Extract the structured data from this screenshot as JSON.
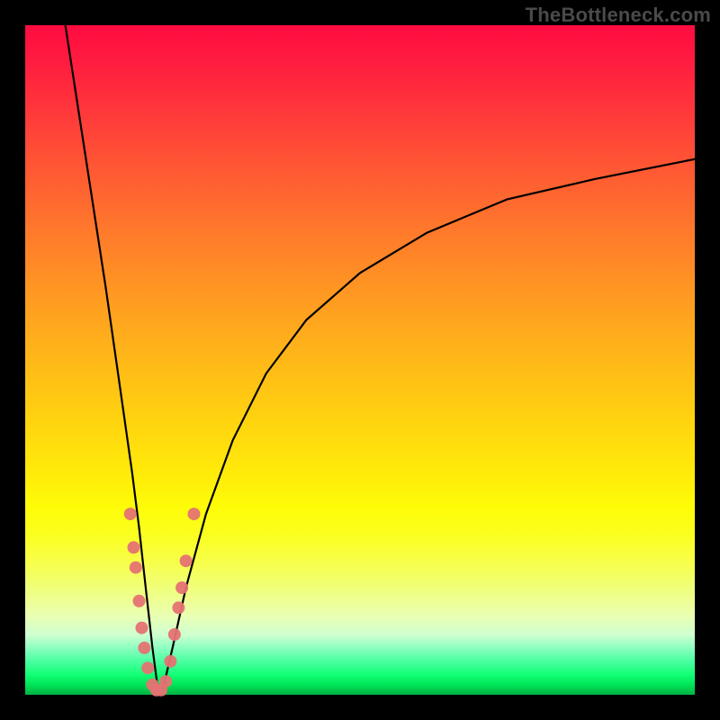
{
  "watermark": "TheBottleneck.com",
  "chart_data": {
    "type": "line",
    "title": "",
    "xlabel": "",
    "ylabel": "",
    "xlim": [
      0,
      100
    ],
    "ylim": [
      0,
      100
    ],
    "grid": false,
    "description": "Bottleneck percentage curve over normalized hardware axis. Descends from 100% at x≈6 to ~0% at the notch around x≈19–21, then asymptotically rises toward ~80% at x=100. Pink dot markers cluster along the curve around the notch between y≈0 and y≈27.",
    "series": [
      {
        "name": "bottleneck-curve",
        "x": [
          6,
          8,
          10,
          12,
          14,
          15,
          16,
          17,
          18,
          19,
          19.8,
          20.6,
          22,
          24,
          27,
          31,
          36,
          42,
          50,
          60,
          72,
          85,
          100
        ],
        "y": [
          100,
          87,
          74,
          61,
          47,
          40,
          33,
          25,
          16,
          7,
          1,
          1,
          7,
          16,
          27,
          38,
          48,
          56,
          63,
          69,
          74,
          77,
          80
        ]
      }
    ],
    "markers": [
      {
        "x": 15.7,
        "y": 27
      },
      {
        "x": 16.2,
        "y": 22
      },
      {
        "x": 16.5,
        "y": 19
      },
      {
        "x": 17.0,
        "y": 14
      },
      {
        "x": 17.4,
        "y": 10
      },
      {
        "x": 17.8,
        "y": 7
      },
      {
        "x": 18.3,
        "y": 4
      },
      {
        "x": 19.0,
        "y": 1.5
      },
      {
        "x": 19.6,
        "y": 0.7
      },
      {
        "x": 20.3,
        "y": 0.7
      },
      {
        "x": 21.0,
        "y": 2
      },
      {
        "x": 21.7,
        "y": 5
      },
      {
        "x": 22.3,
        "y": 9
      },
      {
        "x": 22.9,
        "y": 13
      },
      {
        "x": 23.4,
        "y": 16
      },
      {
        "x": 24.0,
        "y": 20
      },
      {
        "x": 25.2,
        "y": 27
      }
    ],
    "gradient_stops": [
      {
        "pos": 0,
        "color": "#ff0b41"
      },
      {
        "pos": 50,
        "color": "#ffb519"
      },
      {
        "pos": 75,
        "color": "#fbff1f"
      },
      {
        "pos": 100,
        "color": "#00b043"
      }
    ]
  }
}
